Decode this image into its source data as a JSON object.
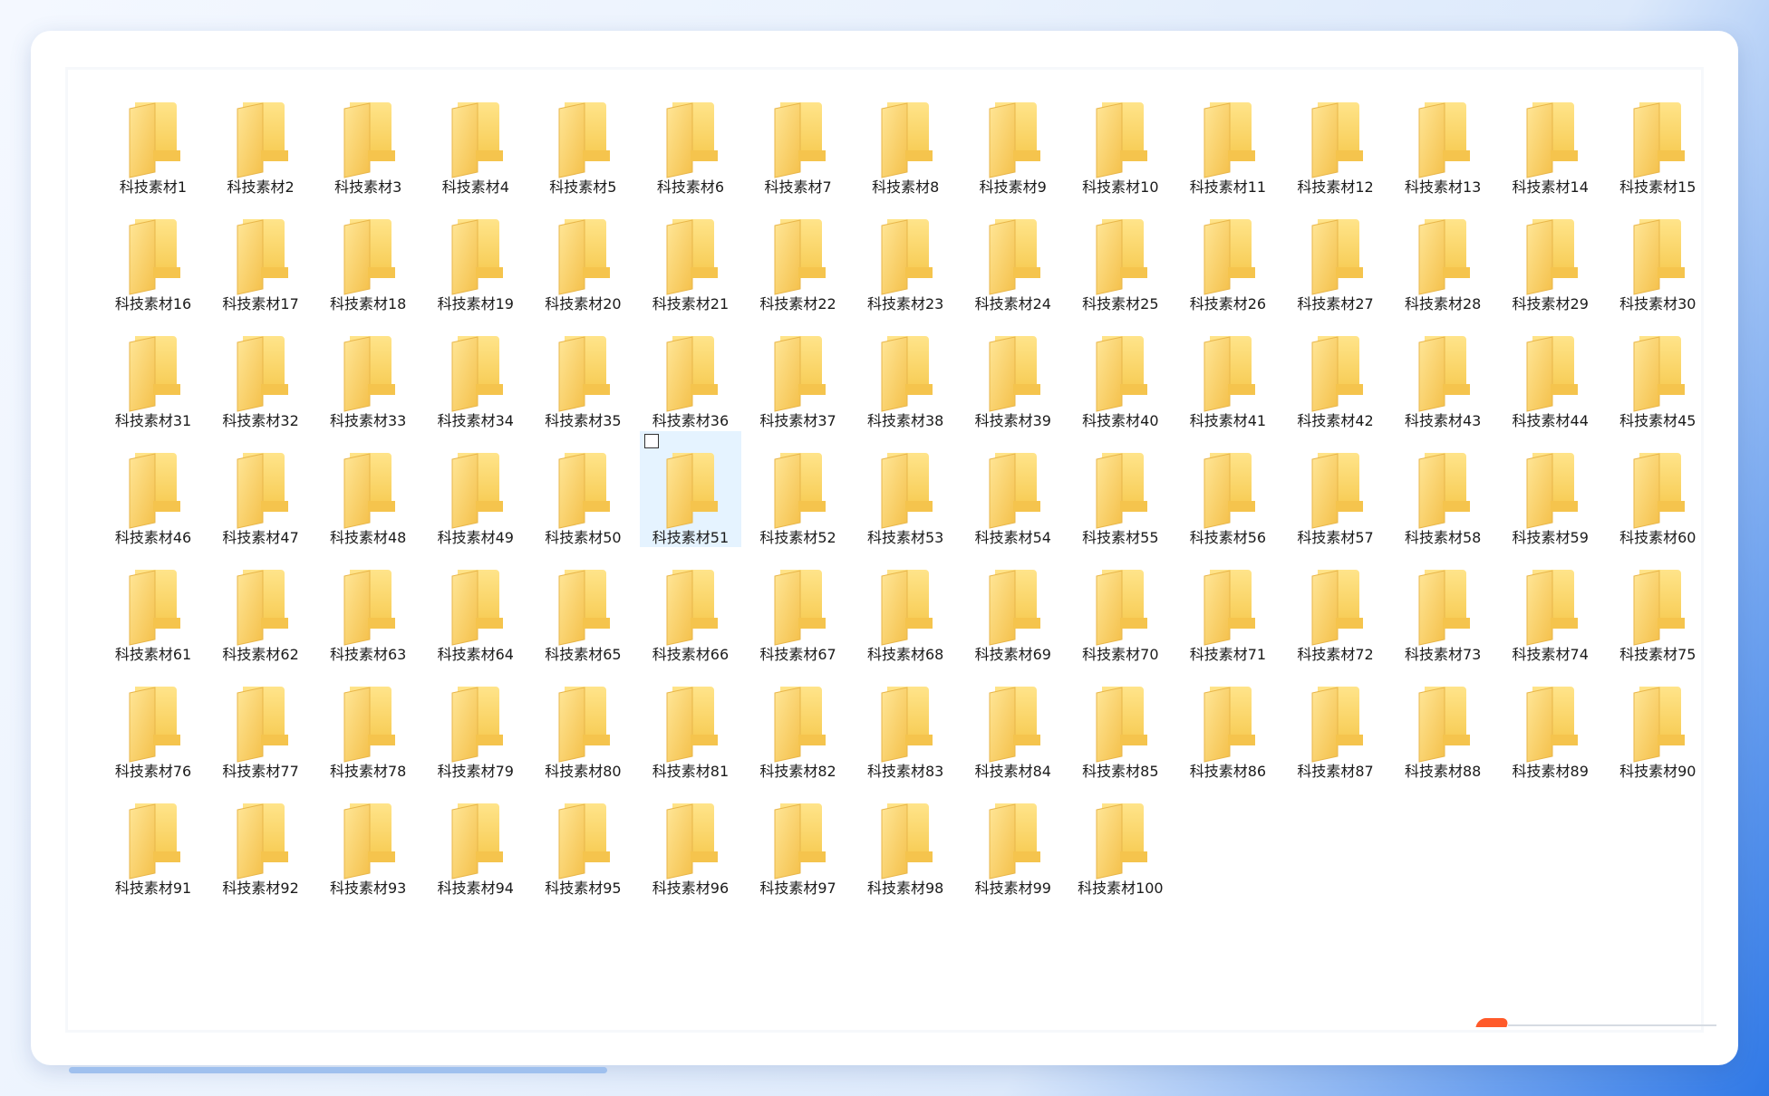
{
  "explorer": {
    "folder_color": "#F9D66C",
    "selected_index": 50,
    "items": [
      "科技素材1",
      "科技素材2",
      "科技素材3",
      "科技素材4",
      "科技素材5",
      "科技素材6",
      "科技素材7",
      "科技素材8",
      "科技素材9",
      "科技素材10",
      "科技素材11",
      "科技素材12",
      "科技素材13",
      "科技素材14",
      "科技素材15",
      "科技素材16",
      "科技素材17",
      "科技素材18",
      "科技素材19",
      "科技素材20",
      "科技素材21",
      "科技素材22",
      "科技素材23",
      "科技素材24",
      "科技素材25",
      "科技素材26",
      "科技素材27",
      "科技素材28",
      "科技素材29",
      "科技素材30",
      "科技素材31",
      "科技素材32",
      "科技素材33",
      "科技素材34",
      "科技素材35",
      "科技素材36",
      "科技素材37",
      "科技素材38",
      "科技素材39",
      "科技素材40",
      "科技素材41",
      "科技素材42",
      "科技素材43",
      "科技素材44",
      "科技素材45",
      "科技素材46",
      "科技素材47",
      "科技素材48",
      "科技素材49",
      "科技素材50",
      "科技素材51",
      "科技素材52",
      "科技素材53",
      "科技素材54",
      "科技素材55",
      "科技素材56",
      "科技素材57",
      "科技素材58",
      "科技素材59",
      "科技素材60",
      "科技素材61",
      "科技素材62",
      "科技素材63",
      "科技素材64",
      "科技素材65",
      "科技素材66",
      "科技素材67",
      "科技素材68",
      "科技素材69",
      "科技素材70",
      "科技素材71",
      "科技素材72",
      "科技素材73",
      "科技素材74",
      "科技素材75",
      "科技素材76",
      "科技素材77",
      "科技素材78",
      "科技素材79",
      "科技素材80",
      "科技素材81",
      "科技素材82",
      "科技素材83",
      "科技素材84",
      "科技素材85",
      "科技素材86",
      "科技素材87",
      "科技素材88",
      "科技素材89",
      "科技素材90",
      "科技素材91",
      "科技素材92",
      "科技素材93",
      "科技素材94",
      "科技素材95",
      "科技素材96",
      "科技素材97",
      "科技素材98",
      "科技素材99",
      "科技素材100"
    ]
  }
}
